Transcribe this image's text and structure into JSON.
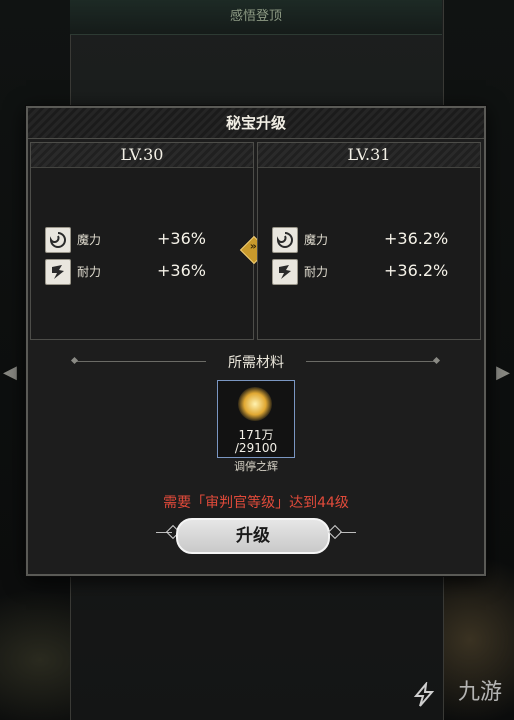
{
  "background": {
    "panel_title": "感悟登顶"
  },
  "dialog": {
    "title": "秘宝升级",
    "current": {
      "level": "LV.30",
      "stats": [
        {
          "icon": "magic-swirl-icon",
          "name": "魔力",
          "value": "+36%"
        },
        {
          "icon": "endurance-icon",
          "name": "耐力",
          "value": "+36%"
        }
      ]
    },
    "next": {
      "level": "LV.31",
      "stats": [
        {
          "icon": "magic-swirl-icon",
          "name": "魔力",
          "value": "+36.2%"
        },
        {
          "icon": "endurance-icon",
          "name": "耐力",
          "value": "+36.2%"
        }
      ]
    },
    "arrow_glyph": "»",
    "materials_title": "所需材料",
    "material": {
      "owned": "171万",
      "required": "/29100",
      "name": "调停之辉"
    },
    "requirement_text": "需要「审判官等级」达到44级",
    "upgrade_label": "升级"
  },
  "watermark": "九游",
  "colors": {
    "warning": "#e04a3a",
    "accent_gold": "#c99a2c",
    "material_border": "#7a96c2"
  }
}
